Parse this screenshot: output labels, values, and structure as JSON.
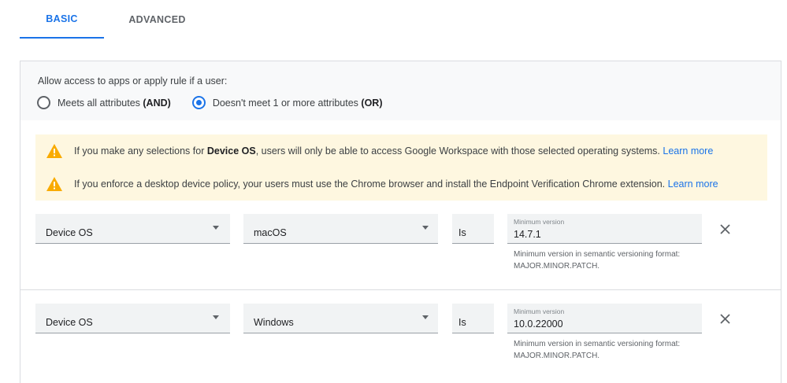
{
  "tabs": [
    {
      "label": "BASIC",
      "active": true
    },
    {
      "label": "ADVANCED",
      "active": false
    }
  ],
  "logic": {
    "prompt": "Allow access to apps or apply rule if a user:",
    "options": [
      {
        "label": "Meets all attributes ",
        "bold": "(AND)",
        "checked": false
      },
      {
        "label": "Doesn't meet 1 or more attributes ",
        "bold": "(OR)",
        "checked": true
      }
    ]
  },
  "warnings": [
    {
      "icon": "warning-icon",
      "pre": "If you make any selections for ",
      "bold": "Device OS",
      "post": ", users will only be able to access Google Workspace with those selected operating systems. ",
      "link": "Learn more"
    },
    {
      "icon": "warning-icon",
      "pre": "If you enforce a desktop device policy, your users must use the Chrome browser and install the Endpoint Verification Chrome extension. ",
      "bold": "",
      "post": "",
      "link": "Learn more"
    }
  ],
  "conditions": [
    {
      "attribute": "Device OS",
      "os": "macOS",
      "operator": "Is",
      "version_label": "Minimum version",
      "version_value": "14.7.1",
      "hint": "Minimum version in semantic versioning format: MAJOR.MINOR.PATCH."
    },
    {
      "attribute": "Device OS",
      "os": "Windows",
      "operator": "Is",
      "version_label": "Minimum version",
      "version_value": "10.0.22000",
      "hint": "Minimum version in semantic versioning format: MAJOR.MINOR.PATCH."
    }
  ],
  "colors": {
    "accent": "#1a73e8",
    "warning_bg": "#fef7e0",
    "warning_icon": "#f9ab00"
  }
}
